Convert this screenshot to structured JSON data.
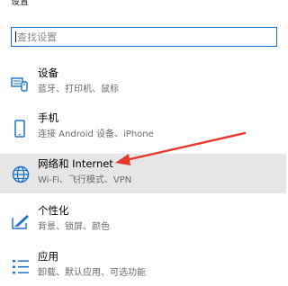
{
  "header": {
    "title": "设置"
  },
  "search": {
    "value": "",
    "placeholder": "查找设置"
  },
  "items": [
    {
      "label": "设备",
      "desc": "蓝牙、打印机、鼠标",
      "icon": "keyboard-device-icon"
    },
    {
      "label": "手机",
      "desc": "连接 Android 设备、iPhone",
      "icon": "phone-icon"
    },
    {
      "label": "网络和 Internet",
      "desc": "Wi-Fi、飞行模式、VPN",
      "icon": "globe-icon",
      "selected": true
    },
    {
      "label": "个性化",
      "desc": "背景、锁屏、颜色",
      "icon": "personalize-pen-icon"
    },
    {
      "label": "应用",
      "desc": "卸载、默认应用、可选功能",
      "icon": "apps-list-icon"
    }
  ],
  "colors": {
    "accent": "#1a73c8",
    "annotation_arrow": "#e8372c",
    "selected_bg": "#e6e6e6"
  }
}
